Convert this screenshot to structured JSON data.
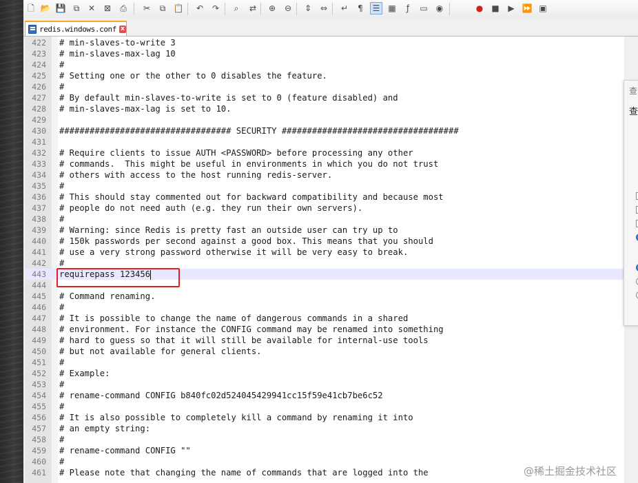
{
  "tab": {
    "file_name": "redis.windows.conf",
    "close_glyph": "x"
  },
  "toolbar": {
    "icons": [
      "new-file-icon",
      "open-file-icon",
      "save-icon",
      "save-all-icon",
      "close-icon",
      "close-all-icon",
      "print-icon",
      "cut-icon",
      "copy-icon",
      "paste-icon",
      "undo-icon",
      "redo-icon",
      "find-icon",
      "replace-icon",
      "zoom-in-icon",
      "zoom-out-icon",
      "sync-vertical-icon",
      "sync-horizontal-icon",
      "word-wrap-icon",
      "show-all-chars-icon",
      "indent-guide-icon",
      "doc-map-icon",
      "function-list-icon",
      "folder-workspace-icon",
      "monitor-icon",
      "record-macro-icon",
      "stop-macro-icon",
      "play-macro-icon",
      "run-macro-multiple-icon",
      "save-macro-icon"
    ]
  },
  "editor": {
    "lines": [
      {
        "num": "422",
        "text": "# min-slaves-to-write 3"
      },
      {
        "num": "423",
        "text": "# min-slaves-max-lag 10"
      },
      {
        "num": "424",
        "text": "#"
      },
      {
        "num": "425",
        "text": "# Setting one or the other to 0 disables the feature."
      },
      {
        "num": "426",
        "text": "#"
      },
      {
        "num": "427",
        "text": "# By default min-slaves-to-write is set to 0 (feature disabled) and"
      },
      {
        "num": "428",
        "text": "# min-slaves-max-lag is set to 10."
      },
      {
        "num": "429",
        "text": ""
      },
      {
        "num": "430",
        "text": "################################## SECURITY ###################################"
      },
      {
        "num": "431",
        "text": ""
      },
      {
        "num": "432",
        "text": "# Require clients to issue AUTH <PASSWORD> before processing any other"
      },
      {
        "num": "433",
        "text": "# commands.  This might be useful in environments in which you do not trust"
      },
      {
        "num": "434",
        "text": "# others with access to the host running redis-server."
      },
      {
        "num": "435",
        "text": "#"
      },
      {
        "num": "436",
        "text": "# This should stay commented out for backward compatibility and because most"
      },
      {
        "num": "437",
        "text": "# people do not need auth (e.g. they run their own servers)."
      },
      {
        "num": "438",
        "text": "#"
      },
      {
        "num": "439",
        "text": "# Warning: since Redis is pretty fast an outside user can try up to"
      },
      {
        "num": "440",
        "text": "# 150k passwords per second against a good box. This means that you should"
      },
      {
        "num": "441",
        "text": "# use a very strong password otherwise it will be very easy to break."
      },
      {
        "num": "442",
        "text": "#"
      },
      {
        "num": "443",
        "text": "requirepass 123456",
        "current": true
      },
      {
        "num": "444",
        "text": ""
      },
      {
        "num": "445",
        "text": "# Command renaming."
      },
      {
        "num": "446",
        "text": "#"
      },
      {
        "num": "447",
        "text": "# It is possible to change the name of dangerous commands in a shared"
      },
      {
        "num": "448",
        "text": "# environment. For instance the CONFIG command may be renamed into something"
      },
      {
        "num": "449",
        "text": "# hard to guess so that it will still be available for internal-use tools"
      },
      {
        "num": "450",
        "text": "# but not available for general clients."
      },
      {
        "num": "451",
        "text": "#"
      },
      {
        "num": "452",
        "text": "# Example:"
      },
      {
        "num": "453",
        "text": "#"
      },
      {
        "num": "454",
        "text": "# rename-command CONFIG b840fc02d524045429941cc15f59e41cb7be6c52"
      },
      {
        "num": "455",
        "text": "#"
      },
      {
        "num": "456",
        "text": "# It is also possible to completely kill a command by renaming it into"
      },
      {
        "num": "457",
        "text": "# an empty string:"
      },
      {
        "num": "458",
        "text": "#"
      },
      {
        "num": "459",
        "text": "# rename-command CONFIG \"\""
      },
      {
        "num": "460",
        "text": "#"
      },
      {
        "num": "461",
        "text": "# Please note that changing the name of commands that are logged into the"
      }
    ]
  },
  "find_panel": {
    "title": "查",
    "label": "查"
  },
  "watermark": "@稀土掘金技术社区",
  "colors": {
    "highlight_box": "#e02020",
    "current_line": "#e8e8ff",
    "tab_accent": "#f5a623"
  }
}
